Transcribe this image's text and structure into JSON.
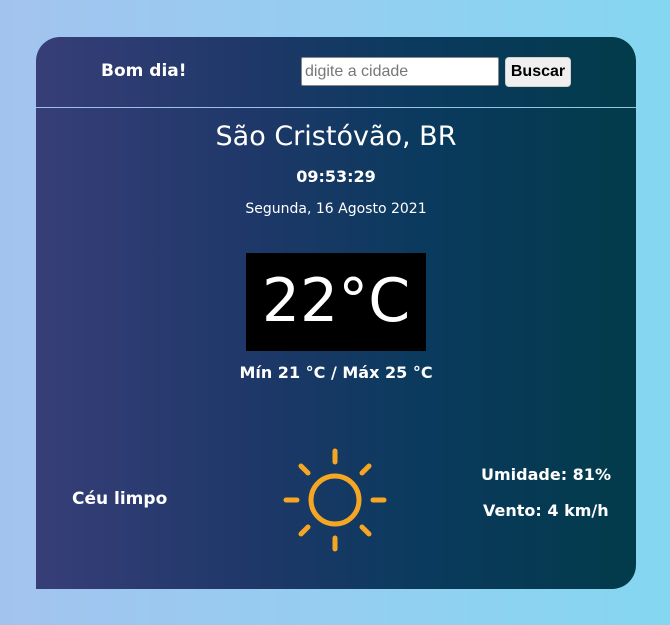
{
  "header": {
    "greeting": "Bom dia!",
    "search_placeholder": "digite a cidade",
    "search_value": "",
    "search_button_label": "Buscar"
  },
  "weather": {
    "city": "São Cristóvão, BR",
    "time": "09:53:29",
    "date": "Segunda, 16 Agosto 2021",
    "temperature": "22°C",
    "min_max": "Mín 21 °C / Máx 25 °C",
    "condition": "Céu limpo",
    "condition_icon": "sun-icon",
    "humidity": "Umidade: 81%",
    "wind": "Vento: 4 km/h"
  },
  "colors": {
    "page_background_left": "#a3c3ef",
    "page_background_right": "#84d6f1",
    "card_left": "#373e78",
    "card_right": "#023b4a",
    "sun": "#f5a623",
    "temperature_box": "#000000"
  }
}
